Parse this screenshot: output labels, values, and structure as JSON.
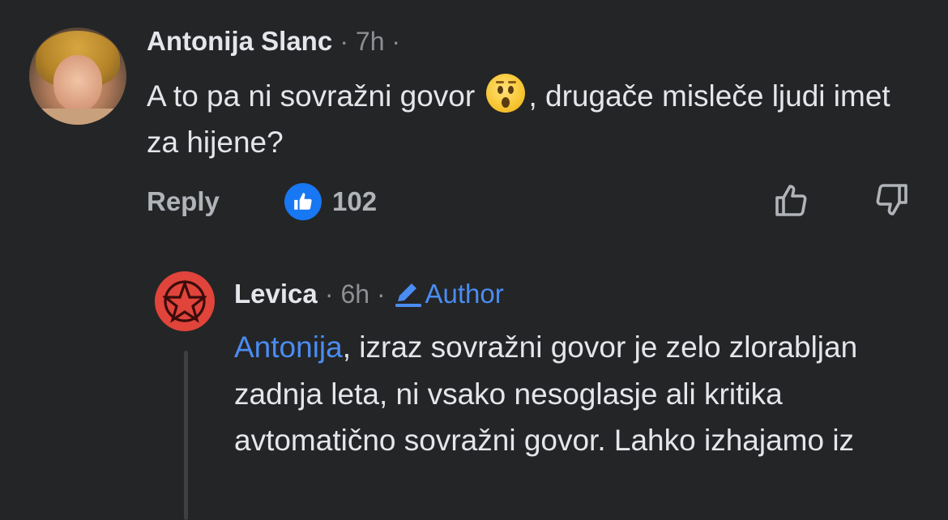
{
  "comment": {
    "author": "Antonija Slanc",
    "time": "7h",
    "text_before_emoji": "A to pa ni sovražni govor",
    "emoji_icon": "hushed-face-emoji",
    "text_after_emoji": ", drugače mislečе ljudi imet za hijene?",
    "reply_label": "Reply",
    "like_count": "102"
  },
  "reply": {
    "author": "Levica",
    "time": "6h",
    "badge": "Author",
    "mention": "Antonija",
    "text": ", izraz sovražni govor je zelo zlorabljan zadnja leta, ni vsako nesoglasje ali kritika avtomatično sovražni govor. Lahko izhajamo iz"
  },
  "colors": {
    "background": "#242526",
    "accent": "#4a8cf2",
    "like_badge": "#1877f2",
    "avatar_red": "#e0443b"
  }
}
